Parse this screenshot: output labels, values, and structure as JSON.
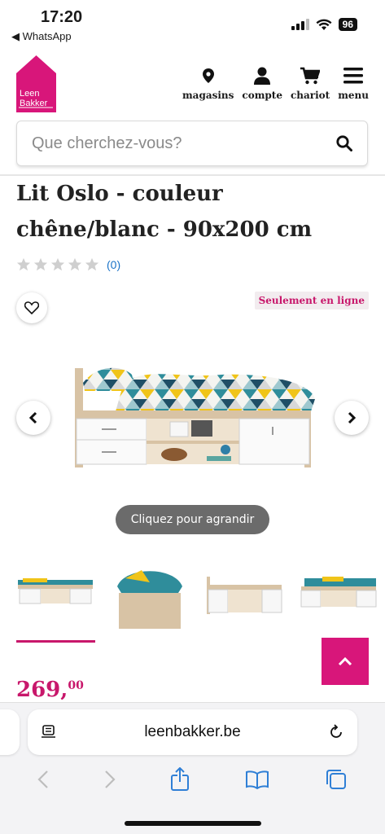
{
  "status_bar": {
    "time": "17:20",
    "back_app": "◀ WhatsApp",
    "battery": "96"
  },
  "header": {
    "logo_line1": "Leen",
    "logo_line2": "Bakker",
    "nav": [
      {
        "label": "magasins",
        "icon": "map-pin-icon"
      },
      {
        "label": "compte",
        "icon": "user-icon"
      },
      {
        "label": "chariot",
        "icon": "cart-icon"
      },
      {
        "label": "menu",
        "icon": "hamburger-icon"
      }
    ]
  },
  "search": {
    "placeholder": "Que cherchez-vous?"
  },
  "product": {
    "title": "Lit Oslo - couleur chêne/blanc - 90x200 cm",
    "rating_stars": 0,
    "rating_max": 5,
    "rating_count": "(0)",
    "online_badge": "Seulement en ligne",
    "zoom_hint": "Cliquez pour agrandir",
    "price_main": "269,",
    "price_cents": "00"
  },
  "gallery": {
    "thumbnail_count": 4,
    "active_index": 0
  },
  "colors": {
    "brand_pink": "#c8176b",
    "rating_link": "#1a73c8"
  },
  "browser": {
    "url": "leenbakker.be"
  }
}
